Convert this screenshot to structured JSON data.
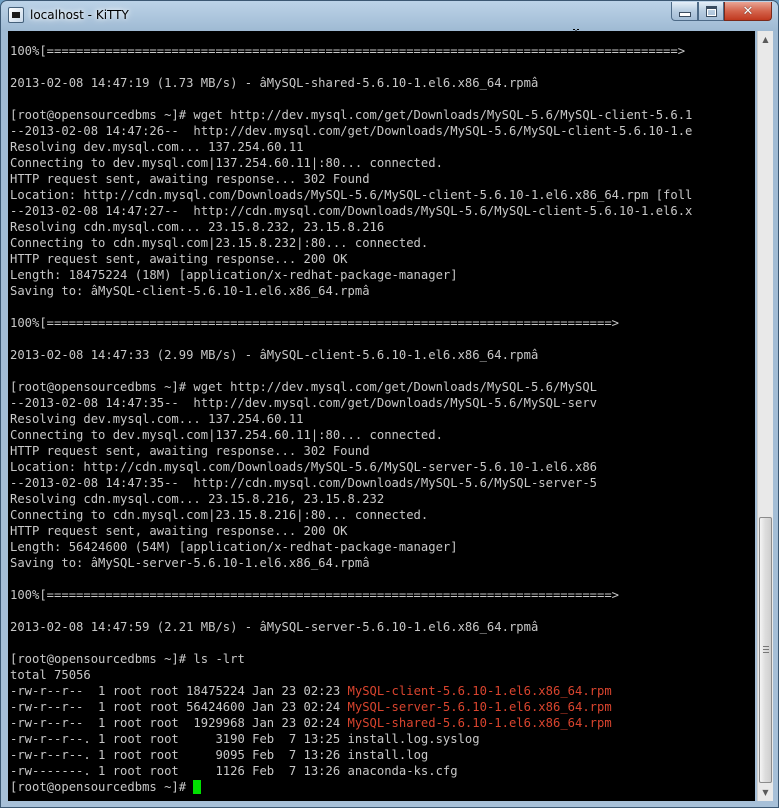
{
  "window": {
    "title": "localhost - KiTTY",
    "controls": {
      "minimize": "minimize",
      "maximize": "maximize",
      "close": "close"
    }
  },
  "terminal": {
    "lines": [
      "100%[======================================================================================>",
      "",
      "2013-02-08 14:47:19 (1.73 MB/s) - âMySQL-shared-5.6.10-1.el6.x86_64.rpmâ",
      "",
      "[root@opensourcedbms ~]# wget http://dev.mysql.com/get/Downloads/MySQL-5.6/MySQL-client-5.6.1",
      "--2013-02-08 14:47:26--  http://dev.mysql.com/get/Downloads/MySQL-5.6/MySQL-client-5.6.10-1.e",
      "Resolving dev.mysql.com... 137.254.60.11",
      "Connecting to dev.mysql.com|137.254.60.11|:80... connected.",
      "HTTP request sent, awaiting response... 302 Found",
      "Location: http://cdn.mysql.com/Downloads/MySQL-5.6/MySQL-client-5.6.10-1.el6.x86_64.rpm [foll",
      "--2013-02-08 14:47:27--  http://cdn.mysql.com/Downloads/MySQL-5.6/MySQL-client-5.6.10-1.el6.x",
      "Resolving cdn.mysql.com... 23.15.8.232, 23.15.8.216",
      "Connecting to cdn.mysql.com|23.15.8.232|:80... connected.",
      "HTTP request sent, awaiting response... 200 OK",
      "Length: 18475224 (18M) [application/x-redhat-package-manager]",
      "Saving to: âMySQL-client-5.6.10-1.el6.x86_64.rpmâ",
      "",
      "100%[=============================================================================>",
      "",
      "2013-02-08 14:47:33 (2.99 MB/s) - âMySQL-client-5.6.10-1.el6.x86_64.rpmâ",
      "",
      "[root@opensourcedbms ~]# wget http://dev.mysql.com/get/Downloads/MySQL-5.6/MySQL",
      "--2013-02-08 14:47:35--  http://dev.mysql.com/get/Downloads/MySQL-5.6/MySQL-serv",
      "Resolving dev.mysql.com... 137.254.60.11",
      "Connecting to dev.mysql.com|137.254.60.11|:80... connected.",
      "HTTP request sent, awaiting response... 302 Found",
      "Location: http://cdn.mysql.com/Downloads/MySQL-5.6/MySQL-server-5.6.10-1.el6.x86",
      "--2013-02-08 14:47:35--  http://cdn.mysql.com/Downloads/MySQL-5.6/MySQL-server-5",
      "Resolving cdn.mysql.com... 23.15.8.216, 23.15.8.232",
      "Connecting to cdn.mysql.com|23.15.8.216|:80... connected.",
      "HTTP request sent, awaiting response... 200 OK",
      "Length: 56424600 (54M) [application/x-redhat-package-manager]",
      "Saving to: âMySQL-server-5.6.10-1.el6.x86_64.rpmâ",
      "",
      "100%[=============================================================================>",
      "",
      "2013-02-08 14:47:59 (2.21 MB/s) - âMySQL-server-5.6.10-1.el6.x86_64.rpmâ",
      "",
      "[root@opensourcedbms ~]# ls -lrt",
      "total 75056"
    ],
    "listing": [
      {
        "meta": "-rw-r--r--  1 root root 18475224 Jan 23 02:23 ",
        "name": "MySQL-client-5.6.10-1.el6.x86_64.rpm",
        "highlight": true
      },
      {
        "meta": "-rw-r--r--  1 root root 56424600 Jan 23 02:24 ",
        "name": "MySQL-server-5.6.10-1.el6.x86_64.rpm",
        "highlight": true
      },
      {
        "meta": "-rw-r--r--  1 root root  1929968 Jan 23 02:24 ",
        "name": "MySQL-shared-5.6.10-1.el6.x86_64.rpm",
        "highlight": true
      },
      {
        "meta": "-rw-r--r--. 1 root root     3190 Feb  7 13:25 ",
        "name": "install.log.syslog",
        "highlight": false
      },
      {
        "meta": "-rw-r--r--. 1 root root     9095 Feb  7 13:26 ",
        "name": "install.log",
        "highlight": false
      },
      {
        "meta": "-rw-------. 1 root root     1126 Feb  7 13:26 ",
        "name": "anaconda-ks.cfg",
        "highlight": false
      }
    ],
    "prompt": "[root@opensourcedbms ~]# ",
    "colors": {
      "background": "#000000",
      "text": "#c8c8c8",
      "rpm_file": "#d9442e",
      "cursor": "#00e000"
    }
  },
  "scrollbar": {
    "position": 0.63,
    "visible_fraction": 0.35
  }
}
